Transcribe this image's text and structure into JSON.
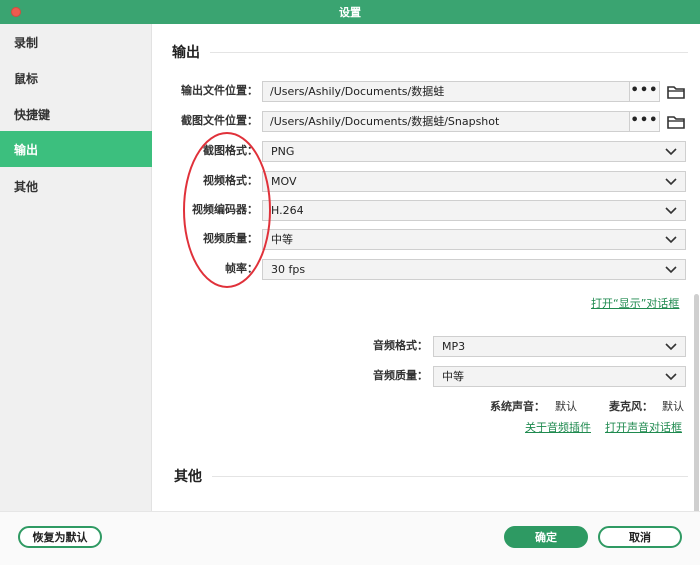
{
  "window": {
    "title": "设置"
  },
  "sidebar": {
    "items": [
      {
        "label": "录制"
      },
      {
        "label": "鼠标"
      },
      {
        "label": "快捷键"
      },
      {
        "label": "输出"
      },
      {
        "label": "其他"
      }
    ],
    "active_index": 3
  },
  "output": {
    "section_title": "输出",
    "output_location": {
      "label": "输出文件位置：",
      "value": "/Users/Ashily/Documents/数据蛙",
      "browse_label": "•••"
    },
    "snapshot_location": {
      "label": "截图文件位置：",
      "value": "/Users/Ashily/Documents/数据蛙/Snapshot",
      "browse_label": "•••"
    },
    "screenshot_format": {
      "label": "截图格式：",
      "value": "PNG"
    },
    "video_format": {
      "label": "视频格式：",
      "value": "MOV"
    },
    "video_codec": {
      "label": "视频编码器：",
      "value": "H.264"
    },
    "video_quality": {
      "label": "视频质量：",
      "value": "中等"
    },
    "frame_rate": {
      "label": "帧率：",
      "value": "30 fps"
    },
    "open_display_dialog": "打开“显示”对话框",
    "audio_format": {
      "label": "音频格式：",
      "value": "MP3"
    },
    "audio_quality": {
      "label": "音频质量：",
      "value": "中等"
    },
    "system_sound": {
      "label": "系统声音：",
      "value": "默认"
    },
    "microphone": {
      "label": "麦克风：",
      "value": "默认"
    },
    "about_audio_plugin": "关于音频插件",
    "open_sound_dialog": "打开声音对话框"
  },
  "other": {
    "section_title": "其他"
  },
  "footer": {
    "reset_label": "恢复为默认",
    "ok_label": "确定",
    "cancel_label": "取消"
  },
  "colors": {
    "titlebar": "#3aa471",
    "accent": "#3cbf7e",
    "primary_button": "#2e9a63",
    "annotation": "#e0313a"
  }
}
